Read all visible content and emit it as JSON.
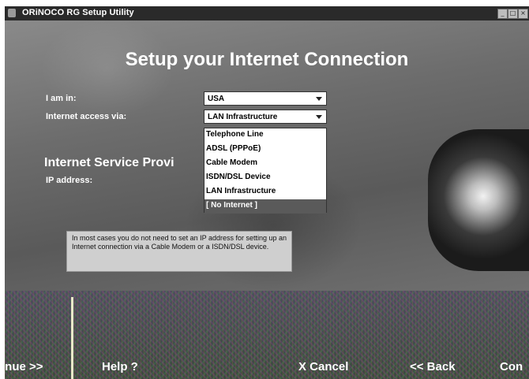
{
  "window": {
    "title": "ORiNOCO RG Setup Utility",
    "minimize_glyph": "_",
    "maximize_glyph": "□",
    "close_glyph": "×"
  },
  "main": {
    "heading": "Setup your Internet Connection",
    "country_label": "I am in:",
    "country_value": "USA",
    "access_label": "Internet access via:",
    "access_value": "LAN Infrastructure",
    "access_options": [
      "Telephone Line",
      "ADSL (PPPoE)",
      "Cable Modem",
      "ISDN/DSL Device",
      "LAN Infrastructure",
      "[ No Internet ]"
    ],
    "section_heading": "Internet Service Provi",
    "ip_label": "IP address:",
    "hint": "In most cases you do not need to set an IP address for setting up an Internet connection via a Cable Modem or a ISDN/DSL device."
  },
  "buttons": {
    "continue_fragment": "inue >>",
    "help": "Help ?",
    "cancel": "X Cancel",
    "back": "<< Back",
    "continue_right": "Con"
  }
}
